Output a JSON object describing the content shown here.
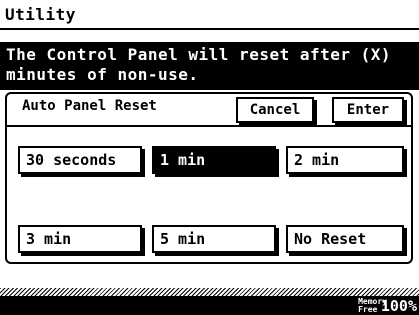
{
  "window": {
    "title": "Utility"
  },
  "message": {
    "line1": "The Control Panel will reset after (X)",
    "line2": "minutes of non-use."
  },
  "panel": {
    "title": "Auto Panel Reset",
    "cancel_label": "Cancel",
    "enter_label": "Enter",
    "options": [
      {
        "label": "30 seconds",
        "selected": false
      },
      {
        "label": "1 min",
        "selected": true
      },
      {
        "label": "2 min",
        "selected": false
      },
      {
        "label": "3 min",
        "selected": false
      },
      {
        "label": "5 min",
        "selected": false
      },
      {
        "label": "No Reset",
        "selected": false
      }
    ]
  },
  "status": {
    "memory_label_top": "Memory",
    "memory_label_bottom": "Free",
    "memory_value": "100%"
  }
}
